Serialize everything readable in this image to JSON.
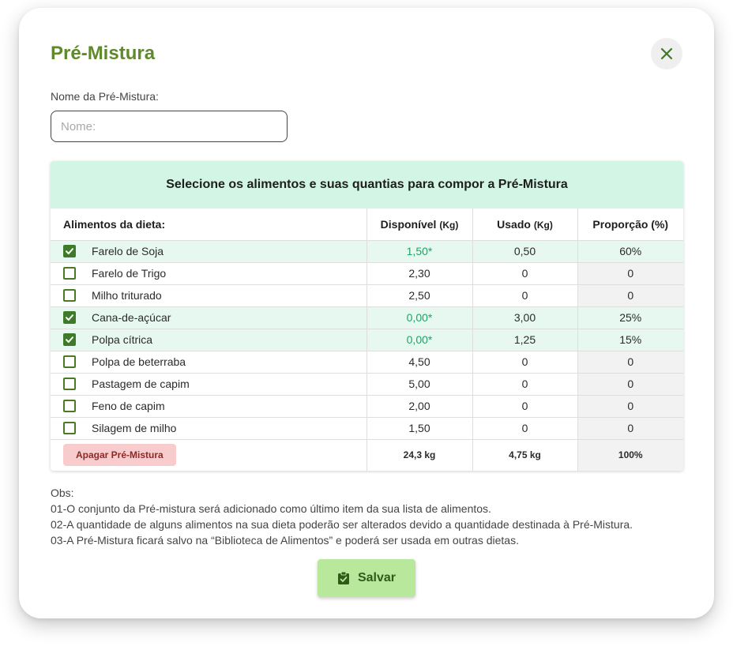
{
  "title": "Pré-Mistura",
  "name_field": {
    "label": "Nome da Pré-Mistura:",
    "placeholder": "Nome:",
    "value": ""
  },
  "table": {
    "banner": "Selecione os alimentos e suas quantias para compor a Pré-Mistura",
    "headers": {
      "food": "Alimentos da dieta:",
      "available": "Disponível",
      "available_unit": "(Kg)",
      "used": "Usado",
      "used_unit": "(Kg)",
      "proportion": "Proporção (%)"
    },
    "rows": [
      {
        "name": "Farelo de Soja",
        "checked": true,
        "available": "1,50*",
        "used": "0,50",
        "proportion": "60%"
      },
      {
        "name": "Farelo de Trigo",
        "checked": false,
        "available": "2,30",
        "used": "0",
        "proportion": "0"
      },
      {
        "name": "Milho triturado",
        "checked": false,
        "available": "2,50",
        "used": "0",
        "proportion": "0"
      },
      {
        "name": "Cana-de-açúcar",
        "checked": true,
        "available": "0,00*",
        "used": "3,00",
        "proportion": "25%"
      },
      {
        "name": "Polpa cítrica",
        "checked": true,
        "available": "0,00*",
        "used": "1,25",
        "proportion": "15%"
      },
      {
        "name": "Polpa de beterraba",
        "checked": false,
        "available": "4,50",
        "used": "0",
        "proportion": "0"
      },
      {
        "name": "Pastagem de capim",
        "checked": false,
        "available": "5,00",
        "used": "0",
        "proportion": "0"
      },
      {
        "name": "Feno de capim",
        "checked": false,
        "available": "2,00",
        "used": "0",
        "proportion": "0"
      },
      {
        "name": "Silagem de milho",
        "checked": false,
        "available": "1,50",
        "used": "0",
        "proportion": "0"
      }
    ],
    "footer": {
      "delete_label": "Apagar Pré-Mistura",
      "total_available": "24,3 kg",
      "total_used": "4,75 kg",
      "total_proportion": "100%"
    }
  },
  "obs": {
    "title": "Obs:",
    "lines": [
      "01-O conjunto da Pré-mistura será adicionado como último item da sua lista de alimentos.",
      "02-A quantidade de alguns alimentos na sua dieta poderão ser alterados devido a quantidade destinada à Pré-Mistura.",
      "03-A Pré-Mistura ficará salvo na “Biblioteca de Alimentos” e poderá ser usada em outras dietas."
    ]
  },
  "save_label": "Salvar",
  "colors": {
    "accent": "#5f8a2b",
    "banner": "#d2f5e6",
    "selected_row": "#e6f8ef",
    "save_button": "#b7e89b",
    "delete_button": "#f8cccc",
    "highlight_value": "#1fa463"
  },
  "icons": {
    "close": "close-icon",
    "checkbox": "checkbox-icon",
    "save": "clipboard-check-icon"
  }
}
